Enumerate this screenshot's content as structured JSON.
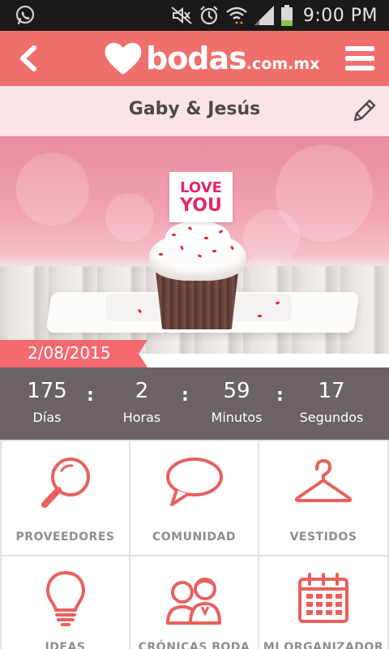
{
  "status_bar": {
    "time": "9:00 PM",
    "icons": [
      "whatsapp-icon",
      "mute-icon",
      "alarm-icon",
      "wifi-icon",
      "signal-icon",
      "battery-icon"
    ]
  },
  "app_bar": {
    "logo_text": "bodas",
    "logo_tld": ".com.mx",
    "icons": [
      "back-icon",
      "heart-logo-icon",
      "menu-icon"
    ]
  },
  "couple": {
    "names": "Gaby & Jesús",
    "edit_icon": "pencil-icon"
  },
  "hero": {
    "card_line1": "LOVE",
    "card_line2": "YOU"
  },
  "wedding_date": "2/08/2015",
  "countdown": {
    "units": [
      {
        "value": "175",
        "label": "Días"
      },
      {
        "value": "2",
        "label": "Horas"
      },
      {
        "value": "59",
        "label": "Minutos"
      },
      {
        "value": "17",
        "label": "Segundos"
      }
    ],
    "separator": ":"
  },
  "menu_grid": {
    "items": [
      {
        "label": "PROVEEDORES",
        "icon": "magnifier-icon"
      },
      {
        "label": "COMUNIDAD",
        "icon": "chat-bubble-icon"
      },
      {
        "label": "VESTIDOS",
        "icon": "hanger-icon"
      },
      {
        "label": "IDEAS",
        "icon": "lightbulb-icon"
      },
      {
        "label": "CRÓNICAS BODA",
        "icon": "couple-icon"
      },
      {
        "label": "MI ORGANIZADOR",
        "icon": "calendar-icon"
      }
    ]
  },
  "colors": {
    "brand": "#ef6f6c",
    "icon_accent": "#e8605e",
    "countdown_bg": "#6a6266",
    "couple_bar_bg": "#fbe4e8",
    "status_bar_bg": "#1a1a1a"
  }
}
